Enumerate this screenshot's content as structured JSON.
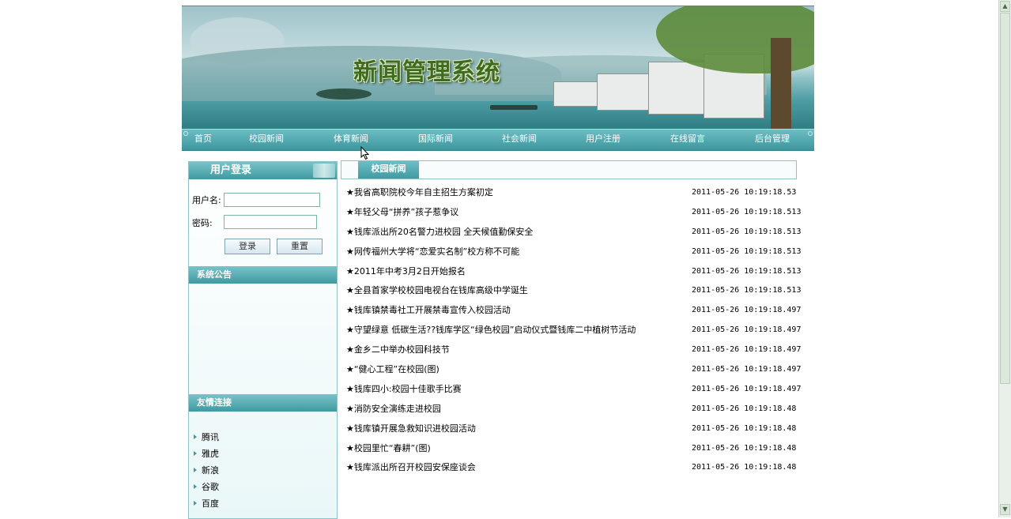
{
  "header": {
    "title": "新闻管理系统"
  },
  "nav": {
    "items": [
      {
        "label": "首页"
      },
      {
        "label": "校园新闻"
      },
      {
        "label": "体育新闻"
      },
      {
        "label": "国际新闻"
      },
      {
        "label": "社会新闻"
      },
      {
        "label": "用户注册"
      },
      {
        "label": "在线留言"
      },
      {
        "label": "后台管理"
      }
    ]
  },
  "login": {
    "title": "用户登录",
    "username_label": "用户名:",
    "username_value": "",
    "password_label": "密码:",
    "password_value": "",
    "login_button": "登录",
    "reset_button": "重置"
  },
  "notice": {
    "title": "系统公告"
  },
  "links": {
    "title": "友情连接",
    "items": [
      "腾讯",
      "雅虎",
      "新浪",
      "谷歌",
      "百度"
    ]
  },
  "news": {
    "tab": "校园新闻",
    "items": [
      {
        "title": "★我省高职院校今年自主招生方案初定",
        "time": "2011-05-26 10:19:18.53"
      },
      {
        "title": "★年轻父母“拼养”孩子惹争议",
        "time": "2011-05-26 10:19:18.513"
      },
      {
        "title": "★钱库派出所20名警力进校园 全天候值勤保安全",
        "time": "2011-05-26 10:19:18.513"
      },
      {
        "title": "★网传福州大学将“恋爱实名制”校方称不可能",
        "time": "2011-05-26 10:19:18.513"
      },
      {
        "title": "★2011年中考3月2日开始报名",
        "time": "2011-05-26 10:19:18.513"
      },
      {
        "title": "★全县首家学校校园电视台在钱库高级中学诞生",
        "time": "2011-05-26 10:19:18.513"
      },
      {
        "title": "★钱库镇禁毒社工开展禁毒宣传入校园活动",
        "time": "2011-05-26 10:19:18.497"
      },
      {
        "title": "★守望绿意 低碳生活??钱库学区“绿色校园”启动仪式暨钱库二中植树节活动",
        "time": "2011-05-26 10:19:18.497"
      },
      {
        "title": "★金乡二中举办校园科技节",
        "time": "2011-05-26 10:19:18.497"
      },
      {
        "title": "★“健心工程”在校园(图)",
        "time": "2011-05-26 10:19:18.497"
      },
      {
        "title": "★钱库四小:校园十佳歌手比赛",
        "time": "2011-05-26 10:19:18.497"
      },
      {
        "title": "★消防安全演练走进校园",
        "time": "2011-05-26 10:19:18.48"
      },
      {
        "title": "★钱库镇开展急救知识进校园活动",
        "time": "2011-05-26 10:19:18.48"
      },
      {
        "title": "★校园里忙“春耕”(图)",
        "time": "2011-05-26 10:19:18.48"
      },
      {
        "title": "★钱库派出所召开校园安保座谈会",
        "time": "2011-05-26 10:19:18.48"
      }
    ]
  },
  "colors": {
    "accent": "#3f9ba2",
    "nav_text": "#ffffff",
    "title_green": "#3f6b1e"
  },
  "icons": {
    "link_bullet": "triangle-right-icon",
    "scroll_up": "arrow-up-icon",
    "scroll_down": "arrow-down-icon"
  }
}
